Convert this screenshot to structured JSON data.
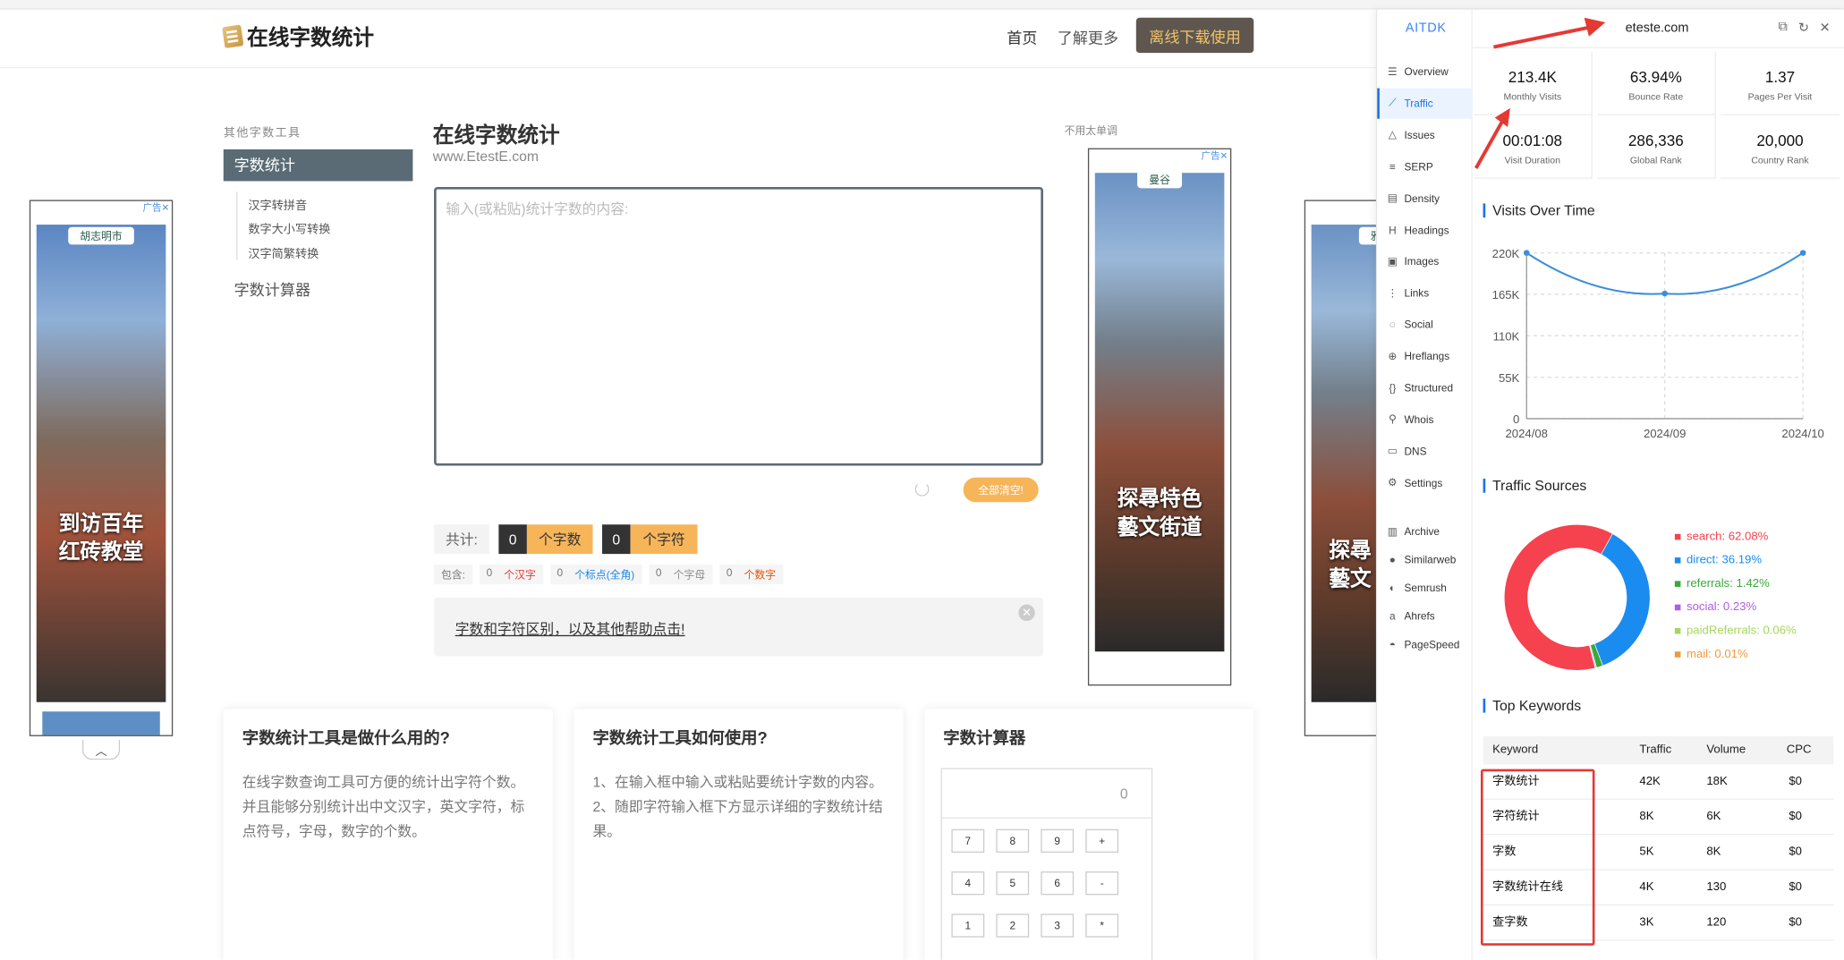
{
  "site": {
    "logo_text": "在线字数统计",
    "nav": {
      "home": "首页",
      "more": "了解更多",
      "download": "离线下载使用"
    }
  },
  "sidebar": {
    "heading": "其他字数工具",
    "active": "字数统计",
    "subitems": [
      "汉字转拼音",
      "数字大小写转换",
      "汉字简繁转换"
    ],
    "calculator": "字数计算器"
  },
  "main": {
    "title": "在线字数统计",
    "subtitle": "www.EtestE.com",
    "textarea_placeholder": "输入(或粘贴)统计字数的内容:",
    "clear_button": "全部清空!",
    "count_label": "共计:",
    "word_count": "0",
    "word_unit": "个字数",
    "char_count": "0",
    "char_unit": "个字符",
    "includes_label": "包含:",
    "includes": [
      {
        "num": "0",
        "unit": "个汉字",
        "color": "#e53935"
      },
      {
        "num": "0",
        "unit": "个标点(全角)",
        "color": "#1e88e5"
      },
      {
        "num": "0",
        "unit": "个字母",
        "color": "#8e8e8e"
      },
      {
        "num": "0",
        "unit": "个数字",
        "color": "#e65100"
      }
    ],
    "help_link": "字数和字符区别，以及其他帮助点击!",
    "right_heading": "不用太单调"
  },
  "ads": {
    "badge": "广告✕",
    "left": {
      "tag": "胡志明市",
      "caption": [
        "到访百年",
        "红砖教堂"
      ]
    },
    "middle": {
      "tag": "曼谷",
      "caption": [
        "探尋特色",
        "藝文街道"
      ]
    },
    "right": {
      "tag": "雅",
      "caption": [
        "探尋",
        "藝文"
      ]
    }
  },
  "cards": [
    {
      "title": "字数统计工具是做什么用的?",
      "body": "在线字数查询工具可方便的统计出字符个数。并且能够分别统计出中文汉字，英文字符，标点符号，字母，数字的个数。"
    },
    {
      "title": "字数统计工具如何使用?",
      "body": "1、在输入框中输入或粘贴要统计字数的内容。 2、随即字符输入框下方显示详细的字数统计结果。"
    },
    {
      "title": "字数计算器",
      "display": "0",
      "keys": [
        "7",
        "8",
        "9",
        "+",
        "4",
        "5",
        "6",
        "-",
        "1",
        "2",
        "3",
        "*"
      ]
    }
  ],
  "extension": {
    "brand": "AITDK",
    "domain": "eteste.com",
    "menu": [
      {
        "label": "Overview",
        "icon": "☰"
      },
      {
        "label": "Traffic",
        "icon": "⟋",
        "active": true
      },
      {
        "label": "Issues",
        "icon": "△"
      },
      {
        "label": "SERP",
        "icon": "≡"
      },
      {
        "label": "Density",
        "icon": "▤"
      },
      {
        "label": "Headings",
        "icon": "H"
      },
      {
        "label": "Images",
        "icon": "▣"
      },
      {
        "label": "Links",
        "icon": "⋮"
      },
      {
        "label": "Social",
        "icon": "◌"
      },
      {
        "label": "Hreflangs",
        "icon": "⊕"
      },
      {
        "label": "Structured",
        "icon": "{}"
      },
      {
        "label": "Whois",
        "icon": "⚲"
      },
      {
        "label": "DNS",
        "icon": "▭"
      },
      {
        "label": "Settings",
        "icon": "⚙"
      }
    ],
    "external": [
      {
        "label": "Archive",
        "icon": "▥"
      },
      {
        "label": "Similarweb",
        "icon": "●"
      },
      {
        "label": "Semrush",
        "icon": "◐"
      },
      {
        "label": "Ahrefs",
        "icon": "a"
      },
      {
        "label": "PageSpeed",
        "icon": "◓"
      }
    ],
    "metrics": [
      {
        "value": "213.4K",
        "label": "Monthly Visits"
      },
      {
        "value": "63.94%",
        "label": "Bounce Rate"
      },
      {
        "value": "1.37",
        "label": "Pages Per Visit"
      },
      {
        "value": "00:01:08",
        "label": "Visit Duration"
      },
      {
        "value": "286,336",
        "label": "Global Rank"
      },
      {
        "value": "20,000",
        "label": "Country Rank"
      }
    ],
    "visits_title": "Visits Over Time",
    "sources_title": "Traffic Sources",
    "keywords_title": "Top Keywords",
    "keyword_headers": [
      "Keyword",
      "Traffic",
      "Volume",
      "CPC"
    ],
    "keywords": [
      [
        "字数统计",
        "42K",
        "18K",
        "$0"
      ],
      [
        "字符统计",
        "8K",
        "6K",
        "$0"
      ],
      [
        "字数",
        "5K",
        "8K",
        "$0"
      ],
      [
        "字数统计在线",
        "4K",
        "130",
        "$0"
      ],
      [
        "查字数",
        "3K",
        "120",
        "$0"
      ]
    ]
  },
  "chart_data": [
    {
      "type": "line",
      "title": "Visits Over Time",
      "x": [
        "2024/08",
        "2024/09",
        "2024/10"
      ],
      "series": [
        {
          "values": [
            220000,
            166000,
            220000
          ]
        }
      ],
      "yticks": [
        "0",
        "55K",
        "110K",
        "165K",
        "220K"
      ],
      "ylim": [
        0,
        220000
      ],
      "color": "#3b8fd9",
      "grid": true
    },
    {
      "type": "pie",
      "title": "Traffic Sources",
      "donut": true,
      "legend_position": "right",
      "slices": [
        {
          "label": "search",
          "value": 62.08,
          "display": "search: 62.08%",
          "color": "#f5424e"
        },
        {
          "label": "direct",
          "value": 36.19,
          "display": "direct: 36.19%",
          "color": "#1a8cf0"
        },
        {
          "label": "referrals",
          "value": 1.42,
          "display": "referrals: 1.42%",
          "color": "#3aa83a"
        },
        {
          "label": "social",
          "value": 0.23,
          "display": "social: 0.23%",
          "color": "#b05ce6"
        },
        {
          "label": "paidReferrals",
          "value": 0.06,
          "display": "paidReferrals: 0.06%",
          "color": "#a6d65a"
        },
        {
          "label": "mail",
          "value": 0.01,
          "display": "mail: 0.01%",
          "color": "#f09a3e"
        }
      ]
    }
  ]
}
